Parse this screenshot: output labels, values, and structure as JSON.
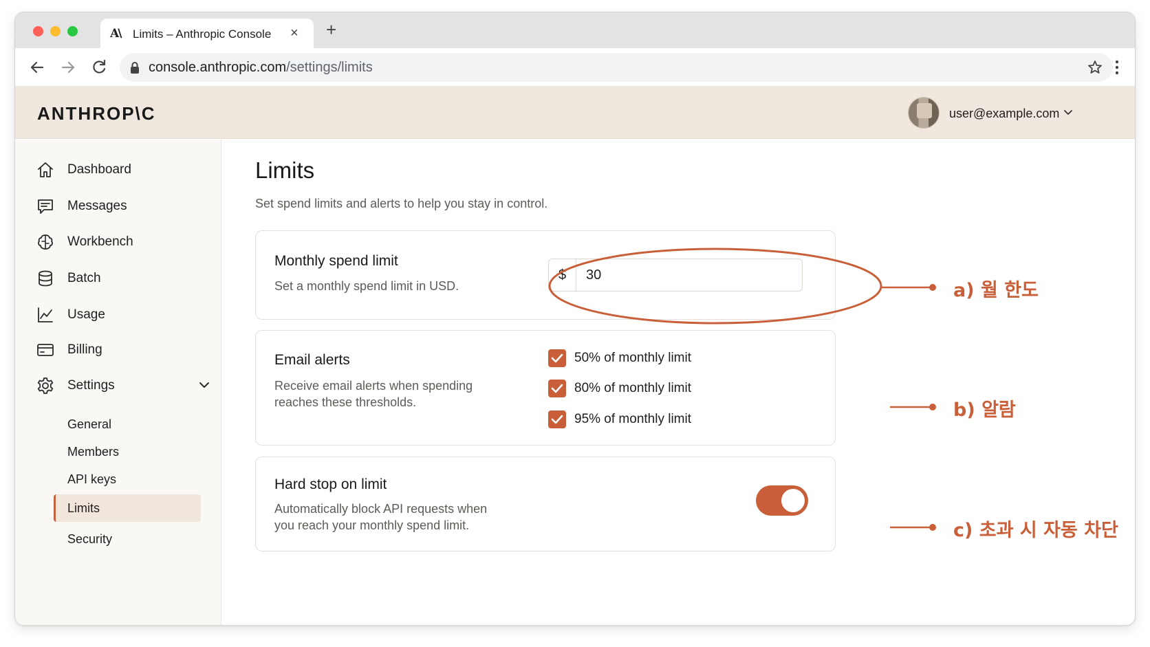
{
  "browser": {
    "tab_logo": "A\\",
    "tab_title": "Limits – Anthropic Console",
    "tab_close": "×",
    "new_tab": "+",
    "url_host": "console.anthropic.com",
    "url_path": "/settings/limits"
  },
  "header": {
    "brand": "ANTHROP\\C",
    "user_email": "user@example.com"
  },
  "sidebar": {
    "items": [
      {
        "label": "Dashboard",
        "icon": "home-icon"
      },
      {
        "label": "Messages",
        "icon": "messages-icon"
      },
      {
        "label": "Workbench",
        "icon": "workbench-icon"
      },
      {
        "label": "Batch",
        "icon": "database-icon"
      },
      {
        "label": "Usage",
        "icon": "chart-icon"
      },
      {
        "label": "Billing",
        "icon": "credit-card-icon"
      },
      {
        "label": "Settings",
        "icon": "gear-icon"
      }
    ],
    "settings_sub": [
      "General",
      "Members",
      "API keys",
      "Limits",
      "Security"
    ],
    "active_sub": "Limits"
  },
  "page": {
    "title": "Limits",
    "subtitle": "Set spend limits and alerts to help you stay in control."
  },
  "spend_card": {
    "title": "Monthly spend limit",
    "description": "Set a monthly spend limit in USD.",
    "currency": "$",
    "value": "30"
  },
  "email_card": {
    "title": "Email alerts",
    "description_line1": "Receive email alerts when spending",
    "description_line2": "reaches these thresholds.",
    "options": [
      {
        "label": "50% of monthly limit",
        "checked": true
      },
      {
        "label": "80% of monthly limit",
        "checked": true
      },
      {
        "label": "95% of monthly limit",
        "checked": true
      }
    ]
  },
  "hardstop_card": {
    "title": "Hard stop on limit",
    "description_line1": "Automatically block API requests when",
    "description_line2": "you reach your monthly spend limit.",
    "enabled": true
  },
  "annotations": {
    "a": "a) 월 한도",
    "b": "b) 알람",
    "c": "c) 초과 시 자동 차단"
  },
  "colors": {
    "accent": "#c95f39",
    "header_bg": "#f0e7df",
    "sidebar_bg": "#faf8f5"
  }
}
